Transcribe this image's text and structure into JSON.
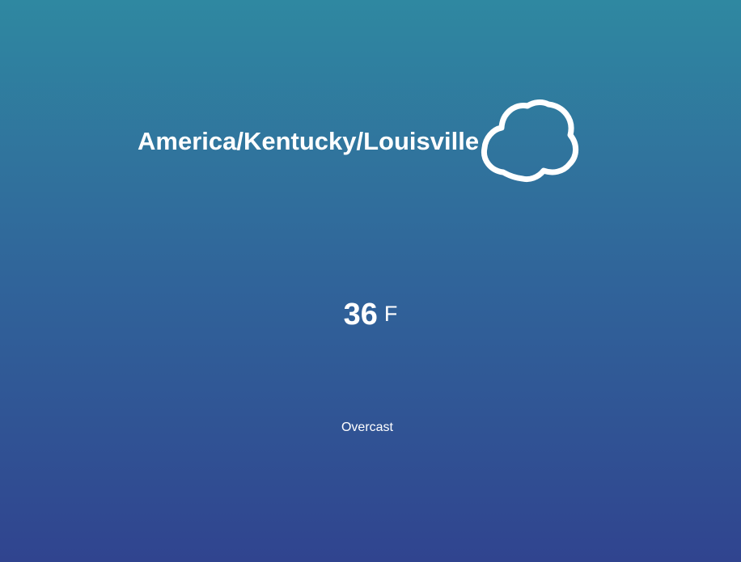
{
  "weather": {
    "location": "America/Kentucky/Louisville",
    "icon": "cloud-icon",
    "temperature": "36",
    "unit": "F",
    "condition": "Overcast"
  },
  "colors": {
    "gradient_top": "#2f88a1",
    "gradient_bottom": "#30448f",
    "text": "#ffffff"
  }
}
